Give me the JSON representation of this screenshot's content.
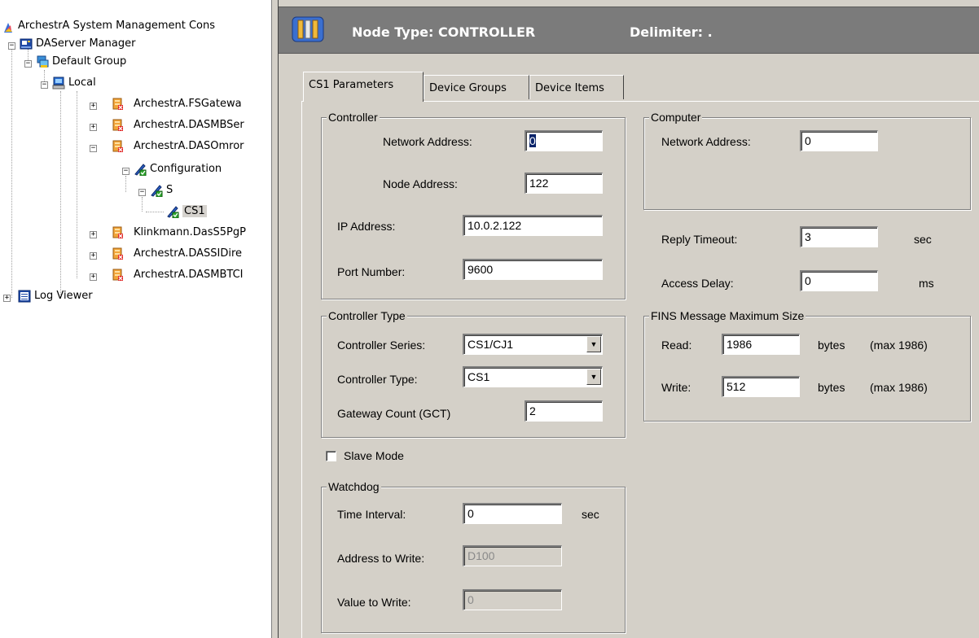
{
  "tree": {
    "root": "ArchestrA System Management Cons",
    "dasm": "DAServer Manager",
    "default_group": "Default Group",
    "local": "Local",
    "fsgateway": "ArchestrA.FSGatewa",
    "dasmbser": "ArchestrA.DASMBSer",
    "dasomron": "ArchestrA.DASOmror",
    "configuration": "Configuration",
    "s": "S",
    "cs1": "CS1",
    "klinkmann": "Klinkmann.DasS5PgP",
    "dassidire": "ArchestrA.DASSIDire",
    "dasmbtc": "ArchestrA.DASMBTCI",
    "log_viewer": "Log Viewer"
  },
  "header": {
    "node_type": "Node Type: CONTROLLER",
    "delimiter": "Delimiter:  ."
  },
  "tabs": {
    "cs1_params": "CS1 Parameters",
    "device_groups": "Device Groups",
    "device_items": "Device Items"
  },
  "controller": {
    "group_title": "Controller",
    "network_address_label": "Network Address:",
    "network_address_value": "0",
    "node_address_label": "Node Address:",
    "node_address_value": "122",
    "ip_address_label": "IP Address:",
    "ip_address_value": "10.0.2.122",
    "port_number_label": "Port Number:",
    "port_number_value": "9600"
  },
  "computer": {
    "group_title": "Computer",
    "network_address_label": "Network Address:",
    "network_address_value": "0"
  },
  "timing": {
    "reply_timeout_label": "Reply Timeout:",
    "reply_timeout_value": "3",
    "reply_timeout_unit": "sec",
    "access_delay_label": "Access Delay:",
    "access_delay_value": "0",
    "access_delay_unit": "ms"
  },
  "controller_type": {
    "group_title": "Controller Type",
    "series_label": "Controller Series:",
    "series_value": "CS1/CJ1",
    "type_label": "Controller Type:",
    "type_value": "CS1",
    "gct_label": "Gateway Count (GCT)",
    "gct_value": "2"
  },
  "fins": {
    "group_title": "FINS Message Maximum Size",
    "read_label": "Read:",
    "read_value": "1986",
    "read_unit": "bytes",
    "read_max": "(max 1986)",
    "write_label": "Write:",
    "write_value": "512",
    "write_unit": "bytes",
    "write_max": "(max 1986)"
  },
  "slave_mode": {
    "label": "Slave Mode",
    "checked": false
  },
  "watchdog": {
    "group_title": "Watchdog",
    "interval_label": "Time Interval:",
    "interval_value": "0",
    "interval_unit": "sec",
    "address_label": "Address to Write:",
    "address_value": "D100",
    "value_label": "Value to Write:",
    "value_value": "0"
  },
  "colors": {
    "header_bg": "#7b7b7b",
    "dialog_bg": "#d4d0c8",
    "selection": "#0a246a"
  }
}
